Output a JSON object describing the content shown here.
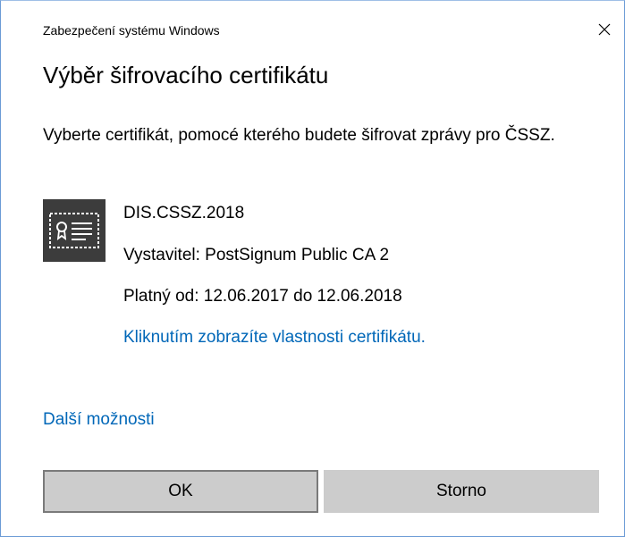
{
  "window": {
    "title": "Zabezpečení systému Windows"
  },
  "dialog": {
    "heading": "Výběr šifrovacího certifikátu",
    "description": "Vyberte certifikát, pomocé kterého budete šifrovat zprávy pro ČSSZ."
  },
  "certificate": {
    "icon": "certificate-icon",
    "name": "DIS.CSSZ.2018",
    "issuer": "Vystavitel: PostSignum Public CA 2",
    "validity": "Platný od: 12.06.2017 do 12.06.2018",
    "properties_link": "Kliknutím zobrazíte vlastnosti certifikátu."
  },
  "more_options": "Další možnosti",
  "buttons": {
    "ok_label": "OK",
    "cancel_label": "Storno"
  },
  "colors": {
    "link": "#0067b8",
    "button_bg": "#cccccc",
    "button_focus_border": "#7a7a7a",
    "icon_bg": "#3c3c3c"
  }
}
